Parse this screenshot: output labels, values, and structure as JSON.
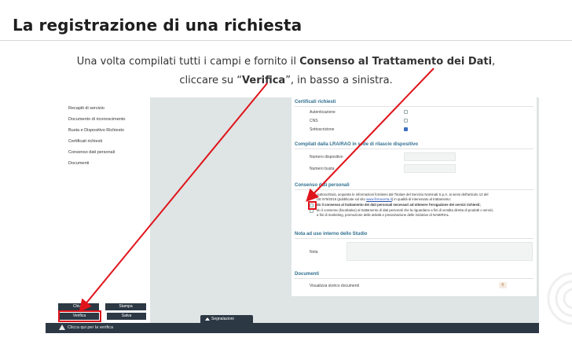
{
  "heading": "La registrazione di una richiesta",
  "intro": {
    "line1_a": "Una volta compilati tutti i campi e fornito il ",
    "line1_b": "Consenso al Trattamento dei Dati",
    "line1_c": ",",
    "line2_a": "cliccare su “",
    "line2_b": "Verifica",
    "line2_c": "”, in basso a sinistra."
  },
  "sidebar": {
    "items": [
      {
        "label": "Recapiti di servizio"
      },
      {
        "label": "Documento di riconoscimento"
      },
      {
        "label": "Busta e Dispositivo Richiesto"
      },
      {
        "label": "Certificati richiesti"
      },
      {
        "label": "Consenso dati personali"
      },
      {
        "label": "Documenti"
      }
    ]
  },
  "form": {
    "certificati": {
      "title": "Certificati richiesti",
      "rows": [
        {
          "label": "Autenticazione",
          "checked": false
        },
        {
          "label": "CNS",
          "checked": false
        },
        {
          "label": "Sottoscrizione",
          "checked": true
        }
      ]
    },
    "compilati": {
      "title": "Compilati dalla LRA/RAO in sede di rilascio dispositivo",
      "fields": [
        {
          "label": "Numero dispositivo",
          "value": ""
        },
        {
          "label": "Numero busta",
          "value": ""
        }
      ]
    },
    "consenso": {
      "title": "Consenso dati personali",
      "p1_a": "Il/La sottoscritto/a, acquisite le informazioni fornitemi dal Titolare del Servizio Nominati S.p.A. ai sensi dell'articolo 13 del",
      "p1_b": "UE 679/2016 (pubblicate sul sito ",
      "p1_link": "www.firmacerta.it",
      "p1_c": ") in qualità di interessato al trattamento:",
      "p2": "do il consenso al trattamento dei dati personali necessari ad ottenere l'erogazione dei servizi richiesti;",
      "p3": "do il consenso (facoltativo) al trattamento di dati personali che la riguardano a fini di vendita diretta di prodotti o servizi,",
      "p4": "a fini di marketing, promozione delle attività e presentazione delle iniziative di NAMIRIAL."
    },
    "nota": {
      "title": "Nota ad uso interno dello Studio",
      "label": "Nota",
      "value": ""
    },
    "documenti": {
      "title": "Documenti",
      "label": "Visualizza storico documenti",
      "search_icon": "search-icon"
    }
  },
  "buttons": {
    "chiudi": "Chiudi",
    "stampa": "Stampa",
    "verifica": "Verifica",
    "salva": "Salva"
  },
  "segnalazioni_tab": "Segnalazioni",
  "status_bar": "Clicca qui per la verifica",
  "colors": {
    "highlight": "#e0151c",
    "dark_bar": "#2c3844",
    "section_title": "#2f6f8f"
  }
}
